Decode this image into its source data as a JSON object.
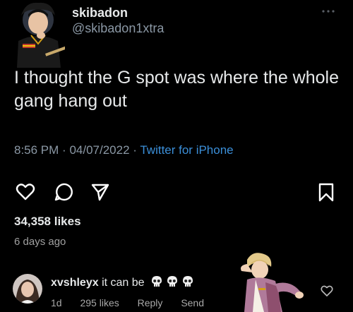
{
  "tweet": {
    "display_name": "skibadon",
    "handle": "@skibadon1xtra",
    "text": "I thought the G spot was where the whole gang hang out",
    "time": "8:56 PM",
    "date": "04/07/2022",
    "source": "Twitter for iPhone"
  },
  "post": {
    "likes": "34,358 likes",
    "age": "6 days ago"
  },
  "comment": {
    "username": "xvshleyx",
    "text": "it can be",
    "emoji": [
      "skull-icon",
      "skull-icon",
      "skull-icon"
    ],
    "age": "1d",
    "likes": "295 likes",
    "reply_label": "Reply",
    "send_label": "Send"
  },
  "icons": {
    "more": "more-icon",
    "like": "heart-icon",
    "comment": "comment-icon",
    "share": "send-icon",
    "save": "bookmark-icon"
  },
  "colors": {
    "background": "#000000",
    "text": "#e7e9ea",
    "secondary_text": "#8b98a5",
    "link": "#3b8fd9"
  }
}
